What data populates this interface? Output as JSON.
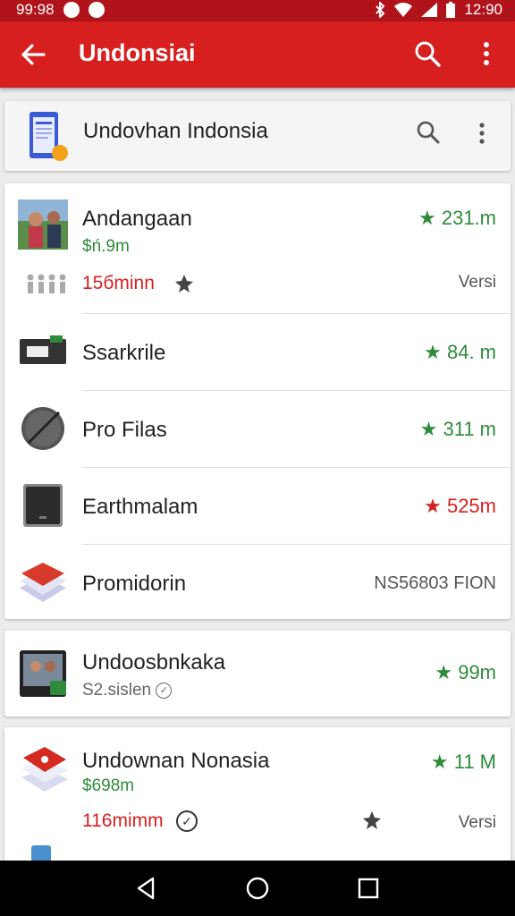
{
  "status": {
    "time_left": "99:98",
    "time_right": "12:90"
  },
  "appbar": {
    "title": "Undonsiai"
  },
  "header_card": {
    "title": "Undovhan Indonsia"
  },
  "apps": [
    {
      "name": "Andangaan",
      "sub": "$ń.9m",
      "rating": "231.m",
      "detail": "15бminn",
      "versi": "Versi"
    },
    {
      "name": "Ssarkrile",
      "rating": "84. m"
    },
    {
      "name": "Pro Filas",
      "rating": "311 m"
    },
    {
      "name": "Earthmalam",
      "rating": "525m"
    },
    {
      "name": "Promidorin",
      "price": "NS56803 FION"
    }
  ],
  "card2": {
    "name": "Undoosbnkaka",
    "sub": "S2.sislen",
    "rating": "99m"
  },
  "card3": {
    "name": "Undownan Nonasia",
    "sub": "$698m",
    "rating": "11 M",
    "detail": "116mimm",
    "versi": "Versi"
  },
  "colors": {
    "brand": "#d71f20",
    "status_bar": "#b0141a",
    "rating_green": "#2e8b3a"
  }
}
